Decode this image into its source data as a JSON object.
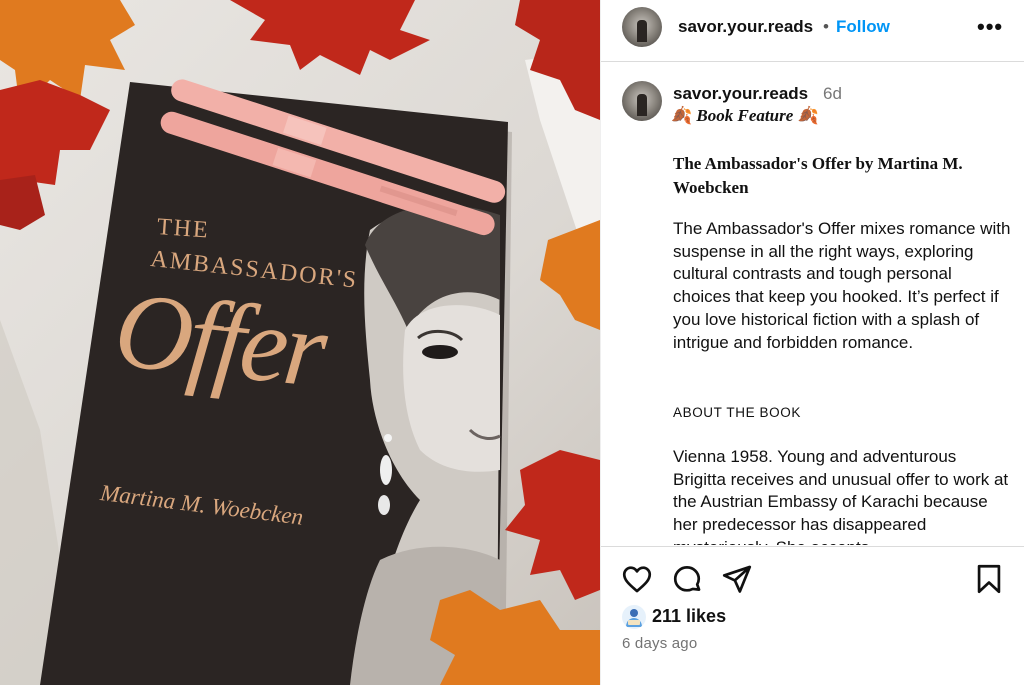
{
  "photo": {
    "cover_line1": "THE",
    "cover_line2": "AMBASSADOR'S",
    "cover_title": "Offer",
    "cover_author": "Martina M. Woebcken",
    "colors": {
      "cover_gold": "#d9a77e",
      "leaf_red": "#c0281b",
      "leaf_orange": "#e07a1f",
      "pen_pink": "#f2b0a8"
    }
  },
  "header": {
    "username": "savor.your.reads",
    "separator": "•",
    "follow_label": "Follow",
    "more_label": "•••"
  },
  "caption": {
    "username": "savor.your.reads",
    "time": "6d",
    "leaf_emoji": "🍂",
    "feature_label": "Book Feature",
    "book_title": "The Ambassador's Offer by Martina M. Woebcken",
    "body": "The Ambassador's Offer mixes romance with suspense in all the right ways, exploring cultural contrasts and tough personal choices that keep you hooked. It’s perfect if you love historical fiction with a splash of intrigue and forbidden romance.",
    "about_heading": "ABOUT THE BOOK",
    "about_body": "Vienna 1958. Young and adventurous Brigitta receives and unusual offer to work at the Austrian Embassy of Karachi because her predecessor has disappeared mysteriously. She accepts"
  },
  "actions": {
    "icons": [
      "heart-icon",
      "comment-icon",
      "share-icon",
      "bookmark-icon"
    ],
    "likes": "211 likes",
    "posted": "6 days ago"
  },
  "colors": {
    "follow_blue": "#0095f6",
    "muted_text": "#737373",
    "divider": "#dbdbdb"
  }
}
